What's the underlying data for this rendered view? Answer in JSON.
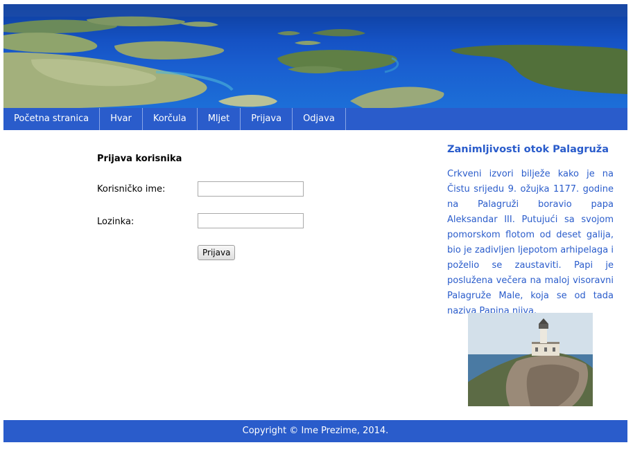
{
  "nav": {
    "items": [
      {
        "label": "Početna stranica"
      },
      {
        "label": "Hvar"
      },
      {
        "label": "Korčula"
      },
      {
        "label": "Mljet"
      },
      {
        "label": "Prijava"
      },
      {
        "label": "Odjava"
      }
    ]
  },
  "login": {
    "title": "Prijava korisnika",
    "username_label": "Korisničko ime:",
    "username_value": "",
    "password_label": "Lozinka:",
    "password_value": "",
    "submit_label": "Prijava"
  },
  "aside": {
    "title": "Zanimljivosti otok Palagruža",
    "text": "Crkveni izvori bilježe kako je na Čistu srijedu 9. ožujka 1177. godine na Palagruži boravio papa Aleksandar III. Putujući sa svojom pomorskom flotom od deset galija, bio je zadivljen ljepotom arhipelaga i poželio se zaustaviti. Papi je poslužena večera na maloj visoravni Palagruže Male, koja se od tada naziva Papina njiva."
  },
  "footer": {
    "copyright": "Copyright © Ime Prezime, 2014."
  },
  "colors": {
    "brand_blue": "#2a5ccb",
    "sea_blue": "#1552c4"
  }
}
